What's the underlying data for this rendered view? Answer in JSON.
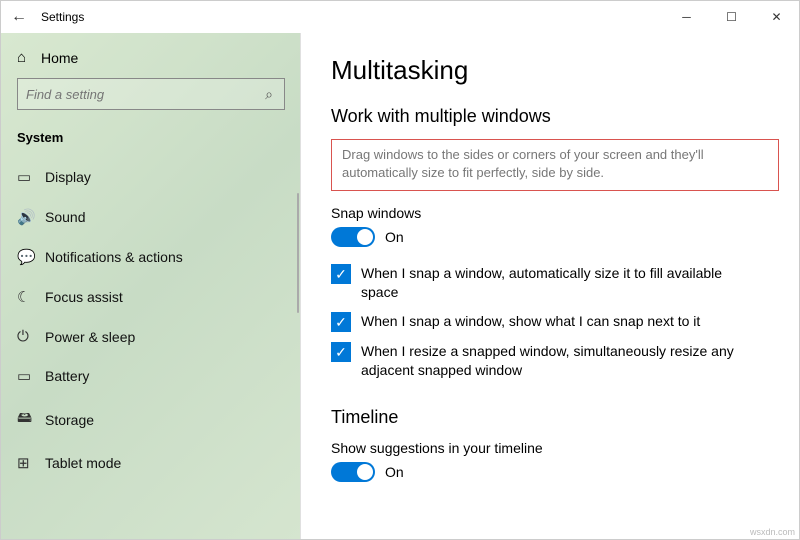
{
  "window": {
    "app_title": "Settings"
  },
  "sidebar": {
    "home_label": "Home",
    "search_placeholder": "Find a setting",
    "category": "System",
    "items": [
      {
        "icon": "display-icon",
        "glyph": "▭",
        "label": "Display"
      },
      {
        "icon": "sound-icon",
        "glyph": "🔊",
        "label": "Sound"
      },
      {
        "icon": "notifications-icon",
        "glyph": "💬",
        "label": "Notifications & actions"
      },
      {
        "icon": "focus-icon",
        "glyph": "☾",
        "label": "Focus assist"
      },
      {
        "icon": "power-icon",
        "glyph": "⏻",
        "label": "Power & sleep"
      },
      {
        "icon": "battery-icon",
        "glyph": "▭",
        "label": "Battery"
      },
      {
        "icon": "storage-icon",
        "glyph": "🖴",
        "label": "Storage"
      },
      {
        "icon": "tablet-icon",
        "glyph": "⊞",
        "label": "Tablet mode"
      }
    ]
  },
  "main": {
    "title": "Multitasking",
    "section1": "Work with multiple windows",
    "desc": "Drag windows to the sides or corners of your screen and they'll automatically size to fit perfectly, side by side.",
    "snap_label": "Snap windows",
    "snap_state": "On",
    "checks": [
      "When I snap a window, automatically size it to fill available space",
      "When I snap a window, show what I can snap next to it",
      "When I resize a snapped window, simultaneously resize any adjacent snapped window"
    ],
    "section2": "Timeline",
    "timeline_label": "Show suggestions in your timeline",
    "timeline_state": "On"
  },
  "watermark": "wsxdn.com"
}
